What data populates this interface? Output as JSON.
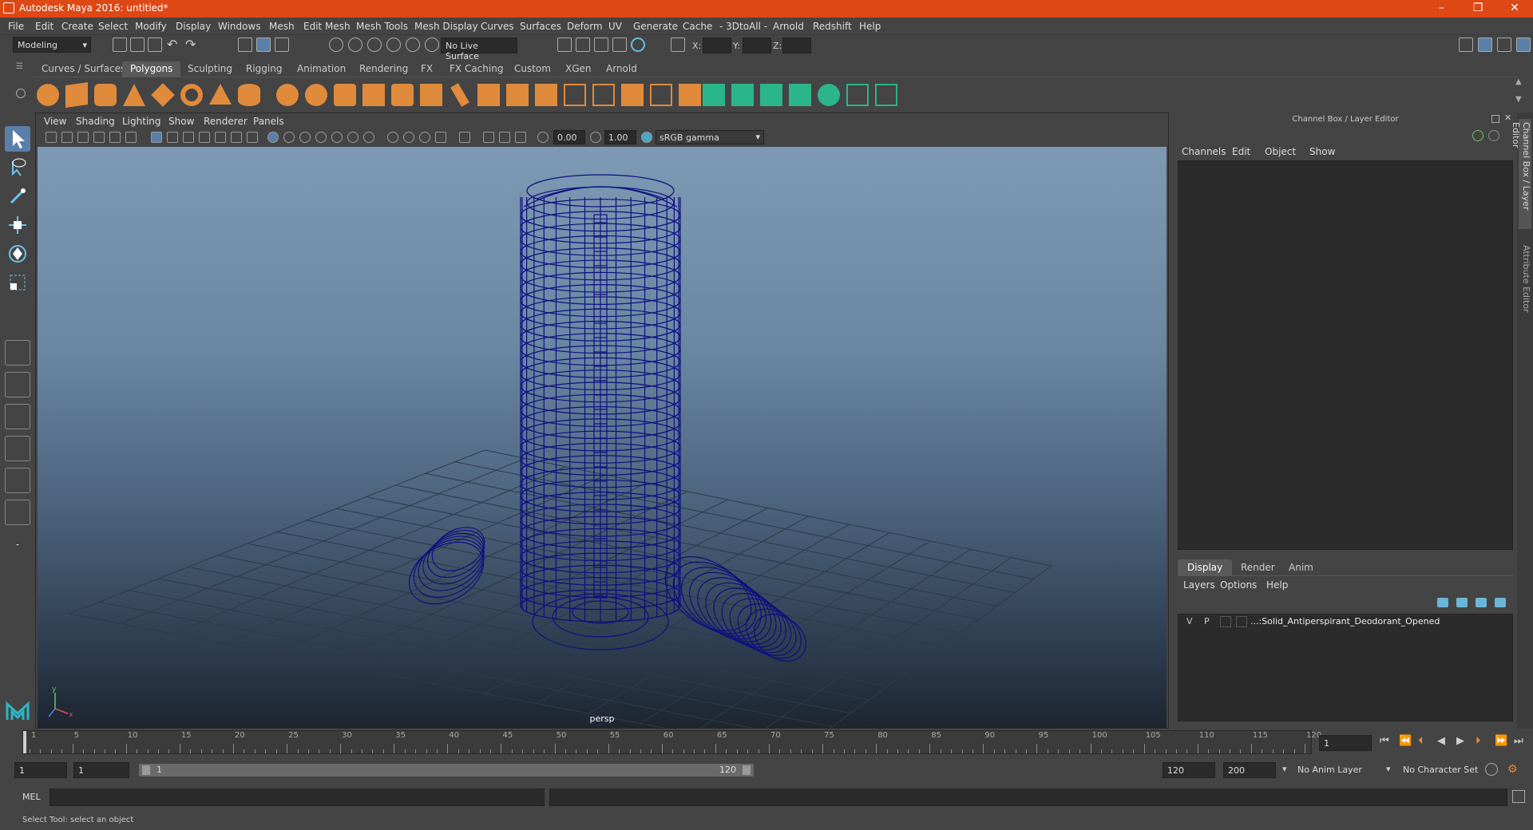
{
  "window": {
    "title": "Autodesk Maya 2016: untitled*"
  },
  "menubar": [
    "File",
    "Edit",
    "Create",
    "Select",
    "Modify",
    "Display",
    "Windows",
    "Mesh",
    "Edit Mesh",
    "Mesh Tools",
    "Mesh Display",
    "Curves",
    "Surfaces",
    "Deform",
    "UV",
    "Generate",
    "Cache",
    "- 3DtoAll -",
    "Arnold",
    "Redshift",
    "Help"
  ],
  "statusline": {
    "mode": "Modeling",
    "live_surface": "No Live Surface",
    "x_label": "X:",
    "y_label": "Y:",
    "z_label": "Z:"
  },
  "shelf_tabs": [
    "Curves / Surfaces",
    "Polygons",
    "Sculpting",
    "Rigging",
    "Animation",
    "Rendering",
    "FX",
    "FX Caching",
    "Custom",
    "XGen",
    "Arnold"
  ],
  "shelf_tab_active": "Polygons",
  "panel_menu": [
    "View",
    "Shading",
    "Lighting",
    "Show",
    "Renderer",
    "Panels"
  ],
  "panel_toolbar": {
    "exposure": "0.00",
    "gamma": "1.00",
    "color_space": "sRGB gamma"
  },
  "viewport": {
    "camera_label": "persp"
  },
  "right_panel": {
    "header": "Channel Box / Layer Editor",
    "channel_menu": [
      "Channels",
      "Edit",
      "Object",
      "Show"
    ],
    "layer_tabs": [
      "Display",
      "Render",
      "Anim"
    ],
    "layer_tab_active": "Display",
    "layer_menu": [
      "Layers",
      "Options",
      "Help"
    ],
    "layer_row": {
      "v": "V",
      "p": "P",
      "name": "...:Solid_Antiperspirant_Deodorant_Opened"
    }
  },
  "side_rail": {
    "tab1": "Channel Box / Layer Editor",
    "tab2": "Attribute Editor"
  },
  "timeline": {
    "labels": [
      "1",
      "5",
      "10",
      "15",
      "20",
      "25",
      "30",
      "35",
      "40",
      "45",
      "50",
      "55",
      "60",
      "65",
      "70",
      "75",
      "80",
      "85",
      "90",
      "95",
      "100",
      "105",
      "110",
      "115",
      "120"
    ],
    "current_frame": "1"
  },
  "range": {
    "start": "1",
    "start_inner": "1",
    "slider_start": "1",
    "slider_end": "120",
    "end_inner": "120",
    "end": "200",
    "anim_layer": "No Anim Layer",
    "character_set": "No Character Set"
  },
  "cmdline": {
    "label": "MEL"
  },
  "helpline": {
    "text": "Select Tool: select an object"
  },
  "colors": {
    "title_bar": "#dd4814",
    "wireframe": "#0c1080",
    "shelf_icon": "#e08a3c",
    "shelf_icon_green": "#2bb58a"
  }
}
